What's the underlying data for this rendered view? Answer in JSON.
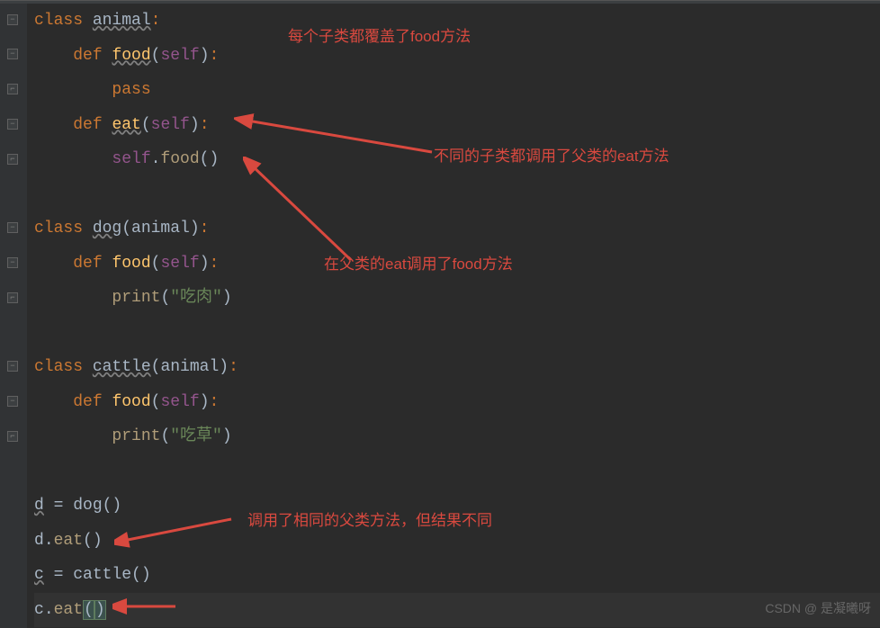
{
  "code": {
    "l1_kw1": "class ",
    "l1_cls": "animal",
    "l1_colon": ":",
    "l2_kw": "def ",
    "l2_fn": "food",
    "l2_p1": "(",
    "l2_self": "self",
    "l2_p2": ")",
    "l2_colon": ":",
    "l3_pass": "pass",
    "l4_kw": "def ",
    "l4_fn": "eat",
    "l4_p1": "(",
    "l4_self": "self",
    "l4_p2": ")",
    "l4_colon": ":",
    "l5_self": "self",
    "l5_dot": ".",
    "l5_call": "food",
    "l5_p": "()",
    "l7_kw": "class ",
    "l7_cls": "dog",
    "l7_p1": "(",
    "l7_base": "animal",
    "l7_p2": ")",
    "l7_colon": ":",
    "l8_kw": "def ",
    "l8_fn": "food",
    "l8_p1": "(",
    "l8_self": "self",
    "l8_p2": ")",
    "l8_colon": ":",
    "l9_call": "print",
    "l9_p1": "(",
    "l9_str": "\"吃肉\"",
    "l9_p2": ")",
    "l11_kw": "class ",
    "l11_cls": "cattle",
    "l11_p1": "(",
    "l11_base": "animal",
    "l11_p2": ")",
    "l11_colon": ":",
    "l12_kw": "def ",
    "l12_fn": "food",
    "l12_p1": "(",
    "l12_self": "self",
    "l12_p2": ")",
    "l12_colon": ":",
    "l13_call": "print",
    "l13_p1": "(",
    "l13_str": "\"吃草\"",
    "l13_p2": ")",
    "l15_var": "d",
    "l15_eq": " = ",
    "l15_call": "dog",
    "l15_p": "()",
    "l16_var": "d",
    "l16_dot": ".",
    "l16_call": "eat",
    "l16_p": "()",
    "l17_var": "c",
    "l17_eq": " = ",
    "l17_call": "cattle",
    "l17_p": "()",
    "l18_var": "c",
    "l18_dot": ".",
    "l18_call": "eat",
    "l18_p1": "(",
    "l18_p2": ")"
  },
  "annotations": {
    "a1": "每个子类都覆盖了food方法",
    "a2": "不同的子类都调用了父类的eat方法",
    "a3": "在父类的eat调用了food方法",
    "a4": "调用了相同的父类方法，但结果不同"
  },
  "watermark": "CSDN @ 是凝曦呀"
}
